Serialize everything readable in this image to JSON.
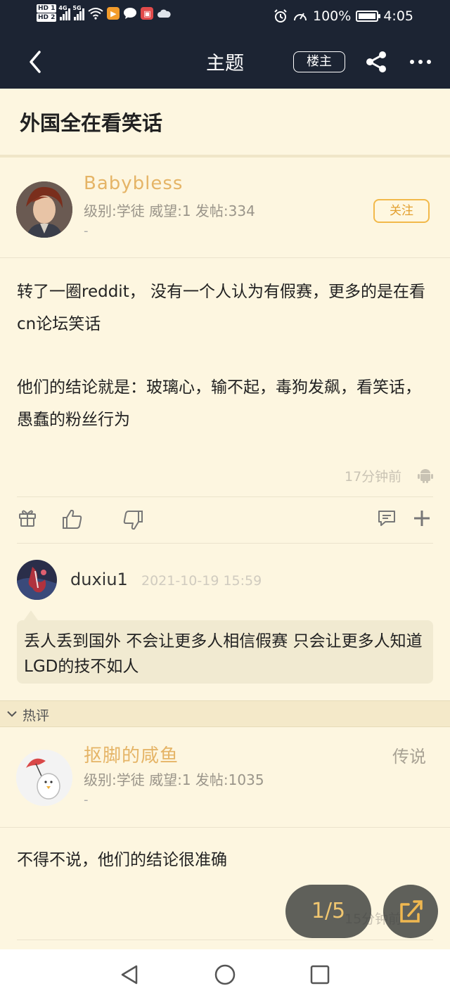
{
  "status_bar": {
    "hd1": "HD 1",
    "hd2": "HD 2",
    "signal1_label": "4G",
    "signal2_label": "5G",
    "battery": "100%",
    "time": "4:05"
  },
  "nav": {
    "title": "主题",
    "owner_button": "楼主"
  },
  "topic": {
    "title": "外国全在看笑话"
  },
  "post": {
    "author": "Babybless",
    "meta": "级别:学徒  威望:1  发帖:334",
    "signature": "-",
    "follow_label": "关注",
    "body_line1": "转了一圈reddit， 没有一个人认为有假赛，更多的是在看cn论坛笑话",
    "body_line2": "他们的结论就是：玻璃心，输不起，毒狗发飙，看笑话，愚蠢的粉丝行为",
    "time": "17分钟前"
  },
  "comment": {
    "author": "duxiu1",
    "date": "2021-10-19 15:59",
    "text": "丢人丢到国外 不会让更多人相信假赛 只会让更多人知道LGD的技不如人"
  },
  "hot_section": {
    "label": "热评"
  },
  "reply": {
    "author": "抠脚的咸鱼",
    "meta": "级别:学徒  威望:1  发帖:1035",
    "signature": "-",
    "tag": "传说",
    "body": "不得不说，他们的结论很准确",
    "time_partial": "15分钟前"
  },
  "pager": {
    "label": "1/5"
  },
  "colors": {
    "header_bg": "#1c2433",
    "page_bg": "#fdf6e0",
    "accent": "#e5b466"
  }
}
